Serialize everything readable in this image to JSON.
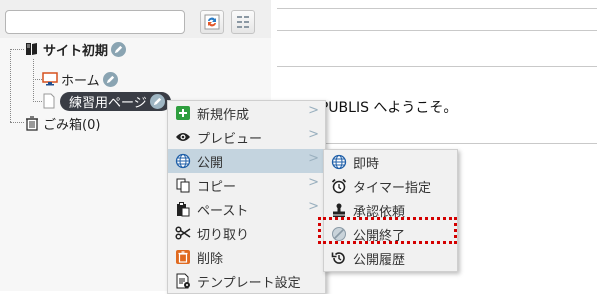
{
  "search": {
    "value": "",
    "placeholder": ""
  },
  "tree": {
    "site_root": "サイト初期",
    "home": "ホーム",
    "practice_page": "練習用ページ",
    "trash": "ごみ箱(0)"
  },
  "editor": {
    "welcome_text": "SITE PUBLIS へようこそ。"
  },
  "context_menu": {
    "items": [
      {
        "label": "新規作成",
        "icon": "plus-icon",
        "submenu": true
      },
      {
        "label": "プレビュー",
        "icon": "eye-icon",
        "submenu": true
      },
      {
        "label": "公開",
        "icon": "globe-icon",
        "submenu": true,
        "active": true
      },
      {
        "label": "コピー",
        "icon": "copy-icon",
        "submenu": true
      },
      {
        "label": "ペースト",
        "icon": "paste-icon",
        "submenu": true
      },
      {
        "label": "切り取り",
        "icon": "scissors-icon",
        "submenu": false
      },
      {
        "label": "削除",
        "icon": "trash-icon",
        "submenu": false
      },
      {
        "label": "テンプレート設定",
        "icon": "template-icon",
        "submenu": false
      }
    ],
    "arrow": ">"
  },
  "publish_submenu": {
    "items": [
      {
        "label": "即時",
        "icon": "globe-icon"
      },
      {
        "label": "タイマー指定",
        "icon": "alarm-clock-icon"
      },
      {
        "label": "承認依頼",
        "icon": "stamp-icon"
      },
      {
        "label": "公開終了",
        "icon": "unpublish-icon",
        "highlighted": true
      },
      {
        "label": "公開履歴",
        "icon": "history-icon"
      }
    ]
  },
  "colors": {
    "accent_green": "#2e9e3e",
    "selection_dark": "#3a3d45",
    "highlight_red": "#d40000",
    "menu_active": "#c4d4df"
  }
}
